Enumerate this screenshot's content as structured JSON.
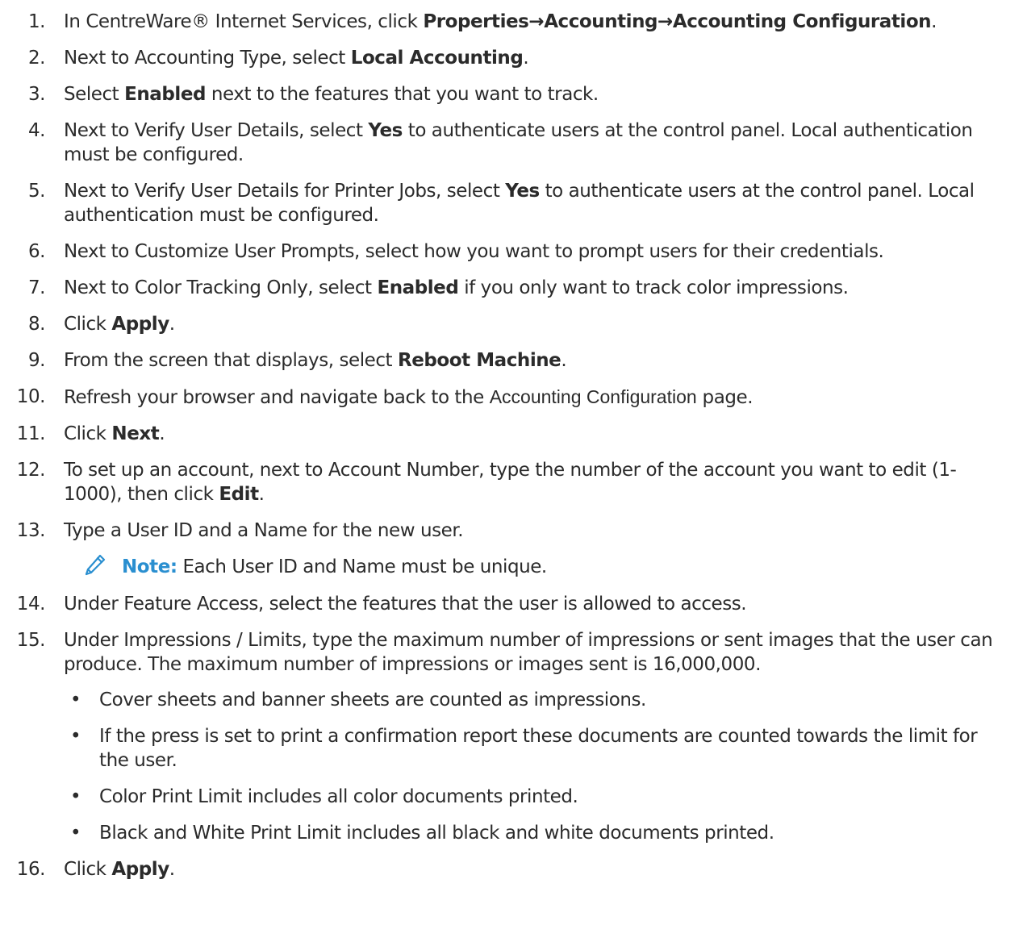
{
  "steps": [
    {
      "n": "1.",
      "a": "In CentreWare® Internet Services, click ",
      "b": "Properties→Accounting→Accounting Configuration",
      "c": "."
    },
    {
      "n": "2.",
      "a": "Next to Accounting Type, select ",
      "b": "Local Accounting",
      "c": "."
    },
    {
      "n": "3.",
      "a": "Select ",
      "b": "Enabled",
      "c": " next to the features that you want to track."
    },
    {
      "n": "4.",
      "a": "Next to Verify User Details, select ",
      "b": "Yes",
      "c": " to authenticate users at the control panel. Local authentication must be configured."
    },
    {
      "n": "5.",
      "a": "Next to Verify User Details for Printer Jobs, select ",
      "b": "Yes",
      "c": " to authenticate users at the control panel. Local authentication must be configured."
    },
    {
      "n": "6.",
      "a": "Next to Customize User Prompts, select how you want to prompt users for their credentials."
    },
    {
      "n": "7.",
      "a": "Next to Color Tracking Only, select ",
      "b": "Enabled",
      "c": " if you only want to track color impressions."
    },
    {
      "n": "8.",
      "a": "Click ",
      "b": "Apply",
      "c": "."
    },
    {
      "n": "9.",
      "a": "From the screen that displays, select ",
      "b": "Reboot Machine",
      "c": "."
    },
    {
      "n": "10.",
      "a": "Refresh your browser and navigate back to the ",
      "alt": "Accounting Configuration",
      "c": " page."
    },
    {
      "n": "11.",
      "a": "Click ",
      "b": "Next",
      "c": "."
    },
    {
      "n": "12.",
      "a": "To set up an account, next to Account Number, type the number of the account you want to edit (1-1000), then click ",
      "b": "Edit",
      "c": "."
    },
    {
      "n": "13.",
      "a": "Type a User ID and a Name for the new user."
    },
    {
      "n": "14.",
      "a": "Under Feature Access, select the features that the user is allowed to access."
    },
    {
      "n": "15.",
      "a": "Under Impressions / Limits, type the maximum number of impressions or sent images that the user can produce. The maximum number of impressions or images sent is 16,000,000."
    },
    {
      "n": "16.",
      "a": "Click ",
      "b": "Apply",
      "c": "."
    }
  ],
  "note": {
    "label": "Note:",
    "text": " Each User ID and Name must be unique.",
    "icon": "pencil-icon",
    "color": "#2a8fd0"
  },
  "bullets": [
    "Cover sheets and banner sheets are counted as impressions.",
    "If the press is set to print a confirmation report these documents are counted towards the limit for the user.",
    "Color Print Limit includes all color documents printed.",
    "Black and White Print Limit includes all black and white documents printed."
  ]
}
